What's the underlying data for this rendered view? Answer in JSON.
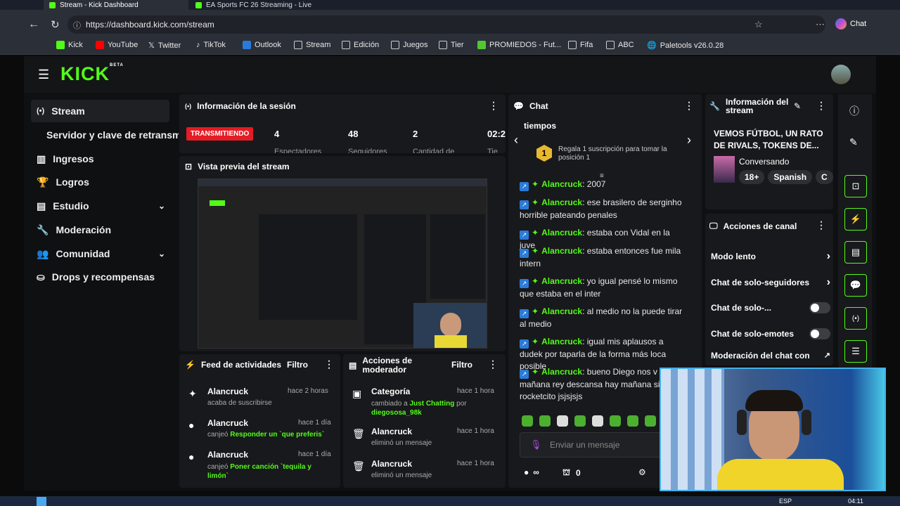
{
  "browser": {
    "tabs": [
      {
        "label": "Stream - Kick Dashboard"
      },
      {
        "label": "EA Sports FC 26 Streaming - Live"
      }
    ],
    "url": "https://dashboard.kick.com/stream",
    "chat_button": "Chat",
    "bookmarks": [
      "Kick",
      "YouTube",
      "Twitter",
      "TikTok",
      "Outlook",
      "Stream",
      "Edición",
      "Juegos",
      "Tier",
      "PROMIEDOS - Fut...",
      "Fifa",
      "ABC",
      "Paletools v26.0.28"
    ]
  },
  "app": {
    "logo": "KICK",
    "logo_beta": "BETA",
    "sidebar": [
      {
        "label": "Stream"
      },
      {
        "label": "Servidor y clave de retransm"
      },
      {
        "label": "Ingresos"
      },
      {
        "label": "Logros"
      },
      {
        "label": "Estudio"
      },
      {
        "label": "Moderación"
      },
      {
        "label": "Comunidad"
      },
      {
        "label": "Drops y recompensas"
      }
    ],
    "session": {
      "title": "Información de la sesión",
      "status": "TRANSMITIENDO",
      "stats": [
        {
          "value": "4",
          "label": "Espectadores"
        },
        {
          "value": "48",
          "label": "Seguidores"
        },
        {
          "value": "2",
          "label": "Cantidad de"
        },
        {
          "value": "02:2",
          "label": "Tie"
        }
      ]
    },
    "preview": {
      "title": "Vista previa del stream"
    },
    "feed": {
      "title": "Feed de actividades",
      "filter": "Filtro",
      "items": [
        {
          "name": "Alancruck",
          "time": "hace 2 horas",
          "pre": "acaba de suscribirse",
          "hl": "",
          "post": ""
        },
        {
          "name": "Alancruck",
          "time": "hace 1 día",
          "pre": "canjeó ",
          "hl": "Responder un `que preferis`",
          "post": ""
        },
        {
          "name": "Alancruck",
          "time": "hace 1 día",
          "pre": "canjeó ",
          "hl": "Poner canción `tequila y limón`",
          "post": ""
        }
      ]
    },
    "mod": {
      "title": "Acciones de moderador",
      "filter": "Filtro",
      "items": [
        {
          "name": "Categoría",
          "time": "hace 1 hora",
          "pre": "cambiado a ",
          "hl": "Just Chatting",
          "post": " por ",
          "hl2": "diegososa_98k"
        },
        {
          "name": "Alancruck",
          "time": "hace 1 hora",
          "pre": "eliminó un mensaje",
          "hl": "",
          "post": "",
          "hl2": ""
        },
        {
          "name": "Alancruck",
          "time": "hace 1 hora",
          "pre": "eliminó un mensaje",
          "hl": "",
          "post": "",
          "hl2": ""
        }
      ]
    },
    "chat": {
      "title": "Chat",
      "pinned_top": "tiempos",
      "gift_count": "1",
      "gift_text": "Regala 1 suscripción para tomar la posición 1",
      "messages": [
        {
          "user": "Alancruck",
          "text": "2007"
        },
        {
          "user": "Alancruck",
          "text": "ese brasilero de serginho horrible pateando penales"
        },
        {
          "user": "Alancruck",
          "text": "estaba con Vidal en la juve"
        },
        {
          "user": "Alancruck",
          "text": "estaba entonces fue mila intern"
        },
        {
          "user": "Alancruck",
          "text": "yo igual pensé lo mismo que estaba en el inter"
        },
        {
          "user": "Alancruck",
          "text": "al medio no la puede tirar al medio"
        },
        {
          "user": "Alancruck",
          "text": "igual mis aplausos a dudek por taparla de la forma más loca posible"
        },
        {
          "user": "Alancruck",
          "text": "bueno Diego nos v mañana rey descansa hay mañana si rocketcito jsjsjsjs"
        }
      ],
      "input_placeholder": "Enviar un mensaje",
      "infinity": "∞",
      "count": "0"
    },
    "stream_info": {
      "title": "Información del stream",
      "stream_title": "VEMOS FÚTBOL, UN RATO DE RIVALS, TOKENS DE...",
      "category": "Conversando",
      "tags": [
        "18+",
        "Spanish",
        "C"
      ]
    },
    "channel_actions": {
      "title": "Acciones de canal",
      "items": [
        {
          "label": "Modo lento",
          "kind": "arrow"
        },
        {
          "label": "Chat de solo-seguidores",
          "kind": "arrow"
        },
        {
          "label": "Chat de solo-...",
          "kind": "toggle"
        },
        {
          "label": "Chat de solo-emotes",
          "kind": "toggle"
        },
        {
          "label": "Moderación del chat con",
          "kind": "link"
        }
      ]
    }
  },
  "taskbar": {
    "lang": "ESP",
    "time": "04:11"
  },
  "colors": {
    "accent": "#53fc18",
    "live": "#e31c25",
    "panel": "#18191c"
  }
}
